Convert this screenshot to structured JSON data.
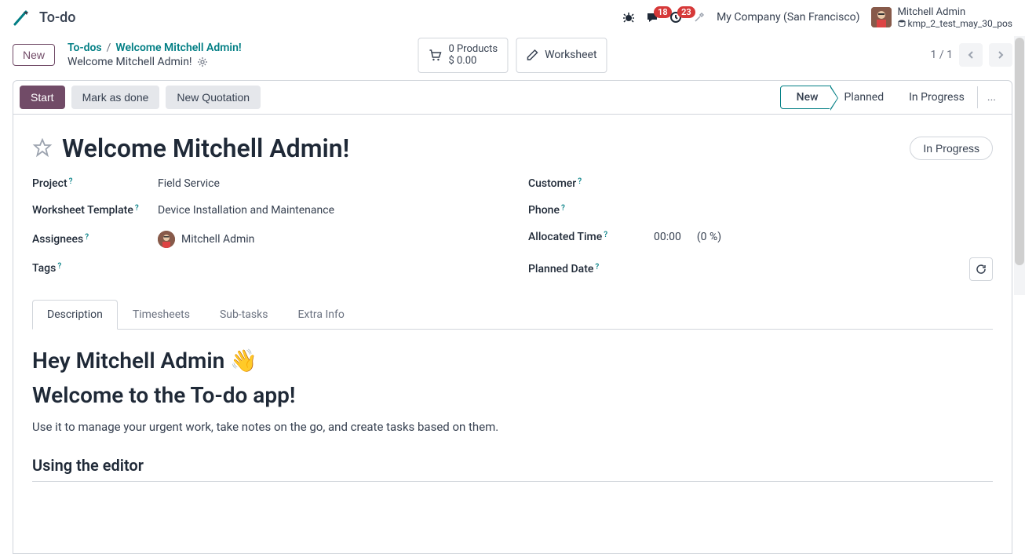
{
  "header": {
    "app_title": "To-do",
    "messages_badge": "18",
    "activities_badge": "23",
    "company_name": "My Company (San Francisco)",
    "user_name": "Mitchell Admin",
    "user_db": "kmp_2_test_may_30_pos"
  },
  "actionbar": {
    "new_label": "New",
    "breadcrumb_root": "To-dos",
    "breadcrumb_current": "Welcome Mitchell Admin!",
    "record_name": "Welcome Mitchell Admin!",
    "products_count": "0 Products",
    "products_amount": "$ 0.00",
    "worksheet_label": "Worksheet",
    "pager_text": "1 / 1"
  },
  "statusbar": {
    "start": "Start",
    "mark_done": "Mark as done",
    "new_quotation": "New Quotation",
    "stages": [
      "New",
      "Planned",
      "In Progress"
    ],
    "more": "..."
  },
  "record": {
    "title": "Welcome Mitchell Admin!",
    "in_progress_btn": "In Progress",
    "fields_left": {
      "project_label": "Project",
      "project_value": "Field Service",
      "worksheet_template_label": "Worksheet Template",
      "worksheet_template_value": "Device Installation and Maintenance",
      "assignees_label": "Assignees",
      "assignees_value": "Mitchell Admin",
      "tags_label": "Tags"
    },
    "fields_right": {
      "customer_label": "Customer",
      "phone_label": "Phone",
      "allocated_time_label": "Allocated Time",
      "allocated_time_value": "00:00",
      "allocated_time_pct": "(0 %)",
      "planned_date_label": "Planned Date"
    }
  },
  "tabs": [
    "Description",
    "Timesheets",
    "Sub-tasks",
    "Extra Info"
  ],
  "description": {
    "heading_line1": "Hey Mitchell Admin 👋",
    "heading_line2": "Welcome to the To-do app!",
    "paragraph": "Use it to manage your urgent work, take notes on the go, and create tasks based on them.",
    "subheading": "Using the editor"
  }
}
